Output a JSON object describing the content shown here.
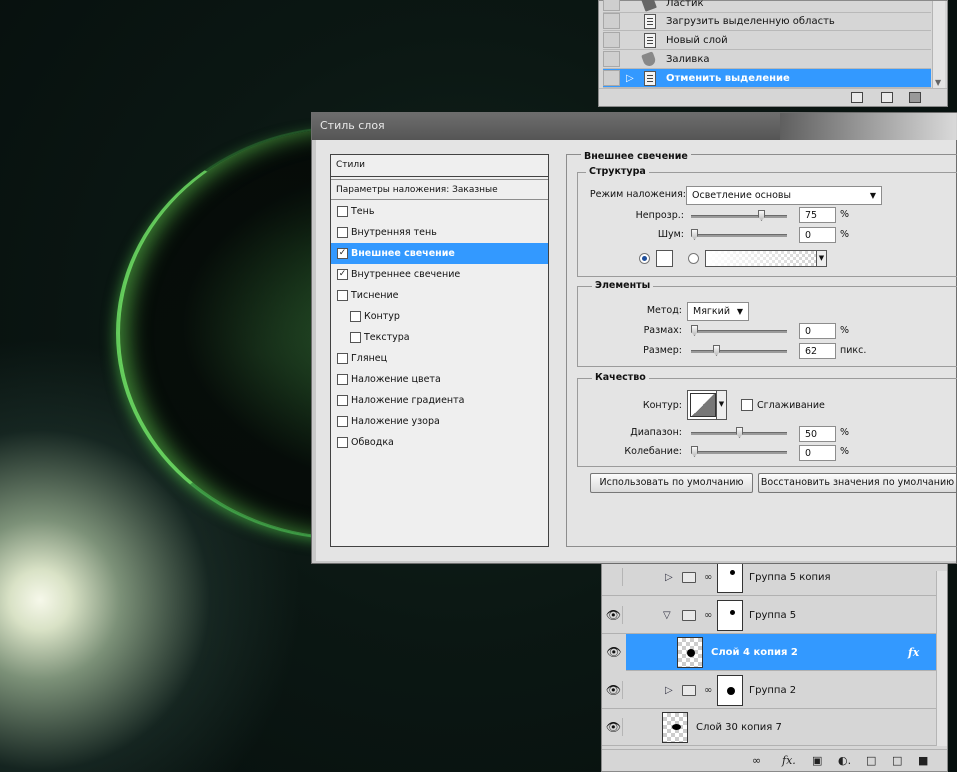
{
  "history": {
    "items": [
      {
        "label": "Ластик",
        "icon": "eraser-icon"
      },
      {
        "label": "Загрузить выделенную область",
        "icon": "document-icon"
      },
      {
        "label": "Новый слой",
        "icon": "document-icon"
      },
      {
        "label": "Заливка",
        "icon": "paint-bucket-icon"
      },
      {
        "label": "Отменить выделение",
        "icon": "document-icon",
        "selected": true
      }
    ]
  },
  "dialog": {
    "title": "Стиль слоя",
    "styles_header": "Стили",
    "blending_options": "Параметры наложения: Заказные",
    "styles": [
      {
        "label": "Тень",
        "checked": false
      },
      {
        "label": "Внутренняя тень",
        "checked": false
      },
      {
        "label": "Внешнее свечение",
        "checked": true,
        "selected": true
      },
      {
        "label": "Внутреннее свечение",
        "checked": true
      },
      {
        "label": "Тиснение",
        "checked": false
      },
      {
        "label": "Контур",
        "checked": false,
        "sub": true
      },
      {
        "label": "Текстура",
        "checked": false,
        "sub": true
      },
      {
        "label": "Глянец",
        "checked": false
      },
      {
        "label": "Наложение цвета",
        "checked": false
      },
      {
        "label": "Наложение градиента",
        "checked": false
      },
      {
        "label": "Наложение узора",
        "checked": false
      },
      {
        "label": "Обводка",
        "checked": false
      }
    ],
    "section_title": "Внешнее свечение",
    "structure": {
      "title": "Структура",
      "blend_mode_label": "Режим наложения:",
      "blend_mode_value": "Осветление основы",
      "opacity_label": "Непрозр.:",
      "opacity_value": "75",
      "opacity_unit": "%",
      "opacity_level": 75,
      "noise_label": "Шум:",
      "noise_value": "0",
      "noise_unit": "%",
      "noise_level": 0,
      "glow_color": "#ffffff"
    },
    "elements": {
      "title": "Элементы",
      "method_label": "Метод:",
      "method_value": "Мягкий",
      "spread_label": "Размах:",
      "spread_value": "0",
      "spread_unit": "%",
      "spread_level": 0,
      "size_label": "Размер:",
      "size_value": "62",
      "size_unit": "пикс.",
      "size_level": 25
    },
    "quality": {
      "title": "Качество",
      "contour_label": "Контур:",
      "antialias_label": "Сглаживание",
      "antialias_checked": false,
      "range_label": "Диапазон:",
      "range_value": "50",
      "range_unit": "%",
      "range_level": 50,
      "jitter_label": "Колебание:",
      "jitter_value": "0",
      "jitter_unit": "%",
      "jitter_level": 0
    },
    "buttons": {
      "make_default": "Использовать по умолчанию",
      "reset_default": "Восстановить значения по умолчанию"
    }
  },
  "layers": {
    "rows": [
      {
        "name": "Группа 5 копия",
        "type": "group",
        "visible": false,
        "expanded": false
      },
      {
        "name": "Группа 5",
        "type": "group",
        "visible": true,
        "expanded": true
      },
      {
        "name": "Слой 4 копия 2",
        "type": "layer",
        "visible": true,
        "selected": true,
        "fx": "fx"
      },
      {
        "name": "Группа 2",
        "type": "group",
        "visible": true,
        "expanded": false
      },
      {
        "name": "Слой 30 копия 7",
        "type": "layer",
        "visible": true
      }
    ]
  },
  "colors": {
    "selection": "#3399ff",
    "panel": "#d6d6d6",
    "dialog_body": "#e4e4e4"
  }
}
